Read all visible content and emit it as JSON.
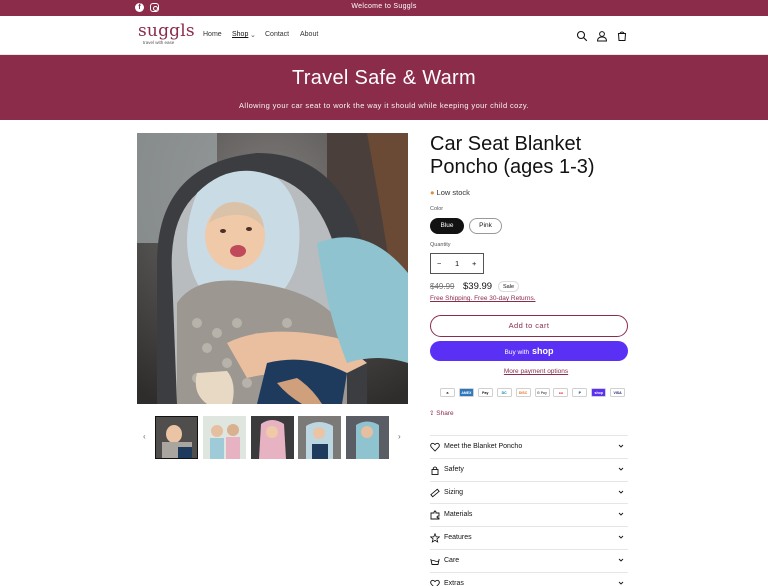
{
  "announcement": "Welcome to Suggls",
  "social": {
    "facebook": "f",
    "instagram_icon": "instagram-icon"
  },
  "brand": {
    "name": "suggls",
    "tagline": "travel with ease"
  },
  "nav": {
    "home": "Home",
    "shop": "Shop",
    "contact": "Contact",
    "about": "About"
  },
  "header_icons": [
    "search-icon",
    "account-icon",
    "cart-icon"
  ],
  "banner": {
    "title": "Travel Safe & Warm",
    "subtitle": "Allowing your car seat to work the way it should while keeping your child cozy."
  },
  "product": {
    "title": "Car Seat Blanket Poncho (ages 1-3)",
    "stock": "Low stock",
    "color_label": "Color",
    "colors": [
      "Blue",
      "Pink"
    ],
    "selected_color": "Blue",
    "quantity_label": "Quantity",
    "quantity": "1",
    "qty_minus": "−",
    "qty_plus": "+",
    "price_original": "$49.99",
    "price_sale": "$39.99",
    "sale_badge": "Sale",
    "shipping": "Free Shipping. Free 30-day Returns.",
    "add_to_cart": "Add to cart",
    "buy_with": "Buy with",
    "buy_shop": "shop",
    "more_payment": "More payment options",
    "share": "Share"
  },
  "payment_icons": [
    {
      "name": "amazon",
      "text": "a",
      "bg": "#ffffff",
      "fg": "#121212"
    },
    {
      "name": "amex",
      "text": "AMEX",
      "bg": "#2e77bc",
      "fg": "#ffffff"
    },
    {
      "name": "apple-pay",
      "text": "Pay",
      "bg": "#ffffff",
      "fg": "#121212"
    },
    {
      "name": "diners",
      "text": "DC",
      "bg": "#ffffff",
      "fg": "#0079be"
    },
    {
      "name": "discover",
      "text": "DISC",
      "bg": "#ffffff",
      "fg": "#e86f1f"
    },
    {
      "name": "google-pay",
      "text": "G Pay",
      "bg": "#ffffff",
      "fg": "#5f6368"
    },
    {
      "name": "mastercard",
      "text": "●●",
      "bg": "#ffffff",
      "fg": "#eb001b"
    },
    {
      "name": "paypal",
      "text": "P",
      "bg": "#ffffff",
      "fg": "#003087"
    },
    {
      "name": "shop-pay",
      "text": "shop",
      "bg": "#5a31f4",
      "fg": "#ffffff"
    },
    {
      "name": "visa",
      "text": "VISA",
      "bg": "#ffffff",
      "fg": "#1a1f71"
    }
  ],
  "accordion": [
    {
      "label": "Meet the Blanket Poncho",
      "icon": "heart-icon"
    },
    {
      "label": "Safety",
      "icon": "lock-icon"
    },
    {
      "label": "Sizing",
      "icon": "ruler-icon"
    },
    {
      "label": "Materials",
      "icon": "puzzle-icon"
    },
    {
      "label": "Features",
      "icon": "star-icon"
    },
    {
      "label": "Care",
      "icon": "washing-icon"
    },
    {
      "label": "Extras",
      "icon": "heart-icon"
    }
  ],
  "colors": {
    "brand": "#8b2c4b",
    "shop_pay": "#5a31f4"
  }
}
